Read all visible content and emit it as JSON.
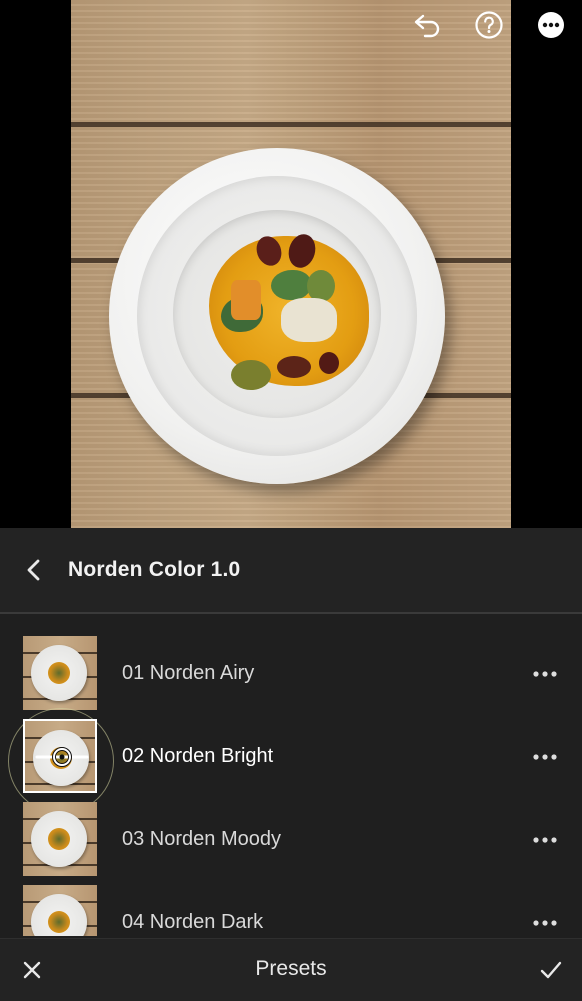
{
  "toolbar": {
    "undo_icon": "undo-icon",
    "help_icon": "help-icon",
    "more_icon": "more-icon"
  },
  "preset_group": {
    "title": "Norden Color 1.0",
    "back_icon": "chevron-left-icon"
  },
  "presets": [
    {
      "label": "01  Norden Airy",
      "selected": false
    },
    {
      "label": "02  Norden Bright",
      "selected": true
    },
    {
      "label": "03  Norden Moody",
      "selected": false
    },
    {
      "label": "04  Norden Dark",
      "selected": false
    }
  ],
  "bottom_bar": {
    "title": "Presets",
    "cancel_icon": "close-icon",
    "confirm_icon": "checkmark-icon"
  },
  "colors": {
    "panel_bg": "#1f1f1f",
    "header_bg": "#232323",
    "text": "#e8e8e8"
  }
}
